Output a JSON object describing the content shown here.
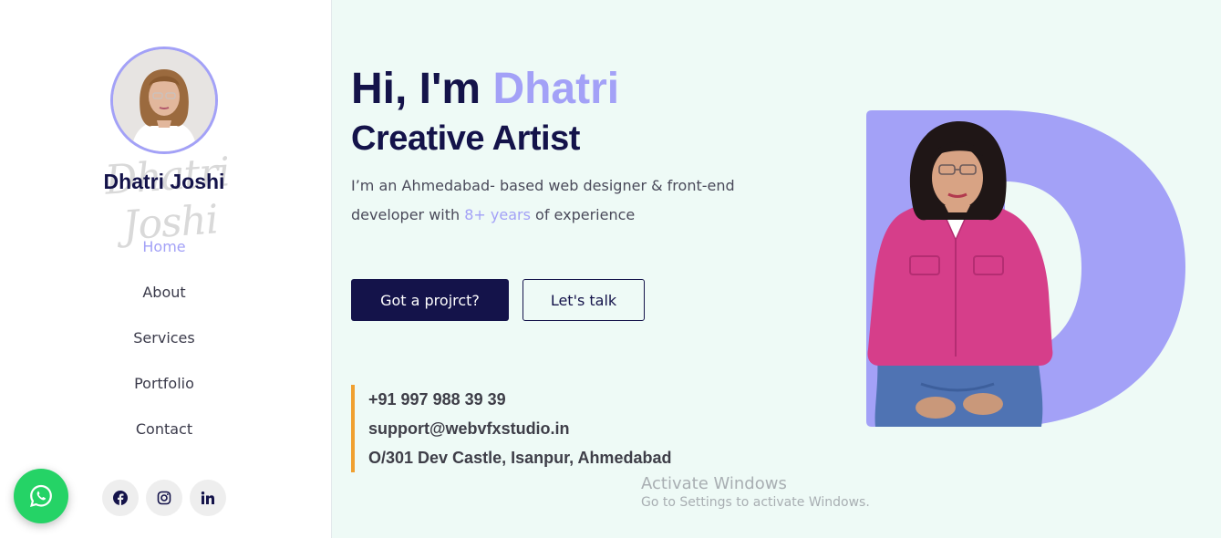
{
  "sidebar": {
    "profile_name": "Dhatri Joshi",
    "signature": "Dhatri Joshi",
    "nav": [
      {
        "label": "Home",
        "active": true
      },
      {
        "label": "About",
        "active": false
      },
      {
        "label": "Services",
        "active": false
      },
      {
        "label": "Portfolio",
        "active": false
      },
      {
        "label": "Contact",
        "active": false
      }
    ],
    "socials": [
      {
        "icon": "facebook-icon"
      },
      {
        "icon": "instagram-icon"
      },
      {
        "icon": "linkedin-icon"
      }
    ]
  },
  "whatsapp": {
    "icon": "whatsapp-icon",
    "color": "#25d366"
  },
  "hero": {
    "greeting_prefix": "Hi, I'm ",
    "greeting_name": "Dhatri",
    "role": "Creative Artist",
    "desc_part1": "I’m an Ahmedabad- based web designer & front-end developer  with ",
    "desc_highlight": "8+ years",
    "desc_part2": " of experience",
    "primary_button": "Got a projrct?",
    "secondary_button": "Let's talk",
    "contact": {
      "phone": "+91 997 988 39 39",
      "email": "support@webvfxstudio.in",
      "address": "O/301 Dev Castle, Isanpur, Ahmedabad"
    }
  },
  "watermark": {
    "title": "Activate Windows",
    "subtitle": "Go to Settings to activate Windows."
  },
  "colors": {
    "navy": "#14134a",
    "accent": "#a3a1f7",
    "contact_bar": "#f0a030",
    "background": "#eefaf6"
  }
}
